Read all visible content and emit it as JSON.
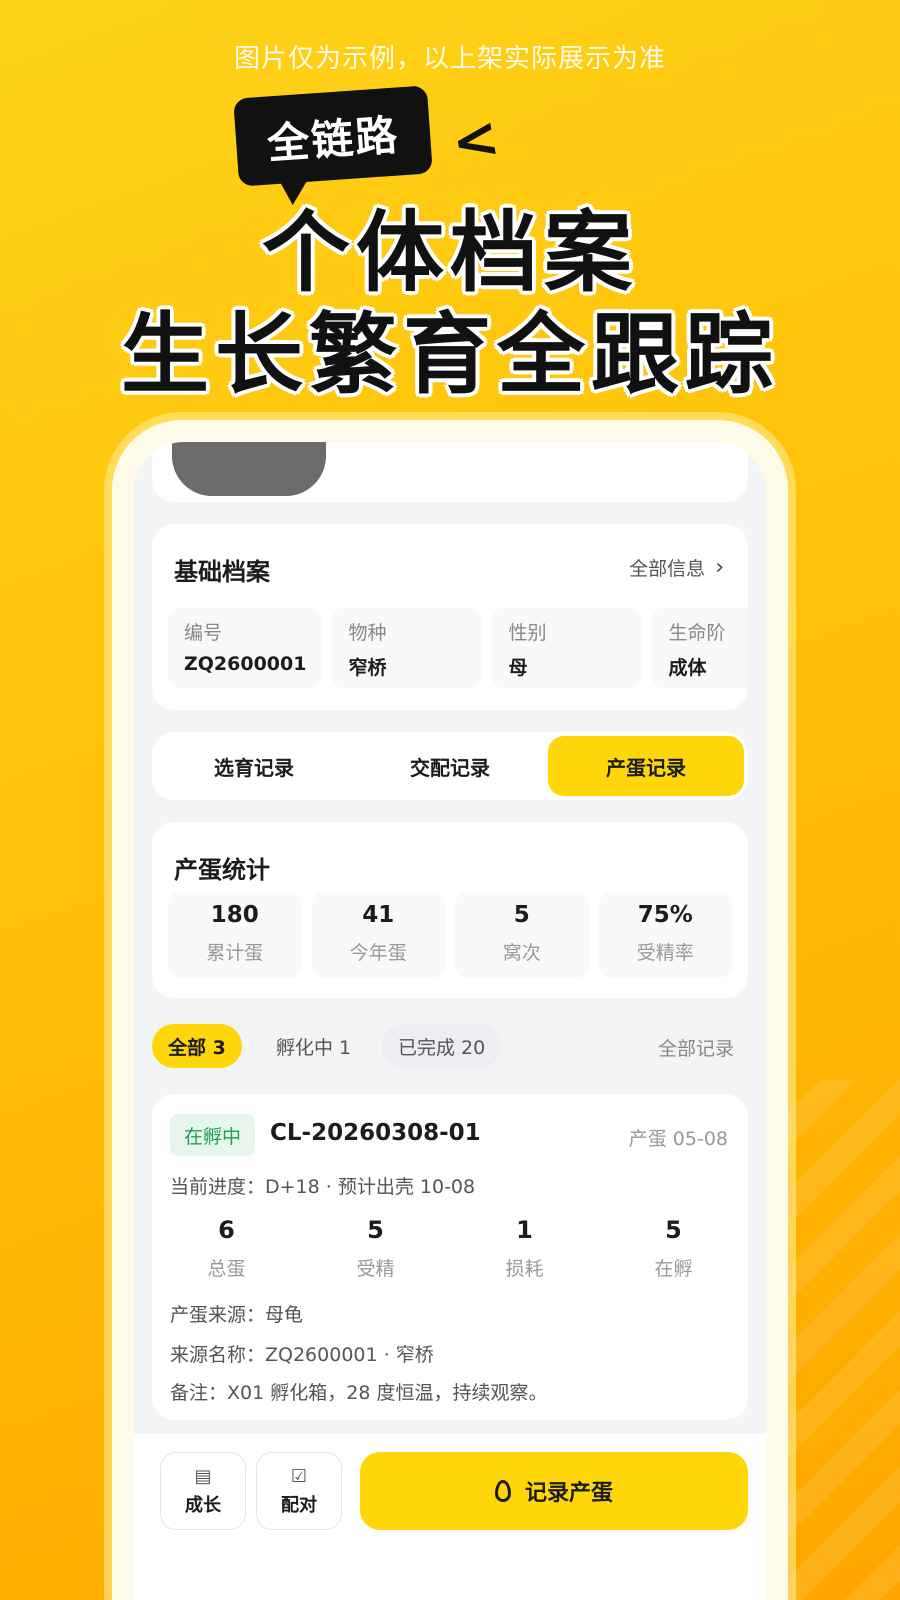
{
  "promo": {
    "disclaimer": "图片仅为示例，以上架实际展示为准",
    "tag": "全链路",
    "headline_1": "个体档案",
    "headline_2": "生长繁育全跟踪"
  },
  "basic_profile": {
    "title": "基础档案",
    "more_label": "全部信息",
    "fields": [
      {
        "label": "编号",
        "value": "ZQ2600001"
      },
      {
        "label": "物种",
        "value": "窄桥"
      },
      {
        "label": "性别",
        "value": "母"
      },
      {
        "label": "生命阶",
        "value": "成体"
      }
    ]
  },
  "tabs": [
    {
      "label": "选育记录",
      "active": false
    },
    {
      "label": "交配记录",
      "active": false
    },
    {
      "label": "产蛋记录",
      "active": true
    }
  ],
  "egg_stats": {
    "title": "产蛋统计",
    "items": [
      {
        "value": "180",
        "label": "累计蛋"
      },
      {
        "value": "41",
        "label": "今年蛋"
      },
      {
        "value": "5",
        "label": "窝次"
      },
      {
        "value": "75%",
        "label": "受精率"
      }
    ]
  },
  "filters": {
    "chips": [
      "全部 3",
      "孵化中 1",
      "已完成 20"
    ],
    "all_records": "全部记录"
  },
  "record": {
    "status": "在孵中",
    "id": "CL-20260308-01",
    "date": "产蛋 05-08",
    "progress": "当前进度：D+18 · 预计出壳 10-08",
    "counts": [
      {
        "value": "6",
        "label": "总蛋"
      },
      {
        "value": "5",
        "label": "受精"
      },
      {
        "value": "1",
        "label": "损耗"
      },
      {
        "value": "5",
        "label": "在孵"
      }
    ],
    "source": "产蛋来源：母龟",
    "source_name": "来源名称：ZQ2600001 · 窄桥",
    "note": "备注：X01 孵化箱，28 度恒温，持续观察。"
  },
  "bottom_bar": {
    "growth_label": "成长",
    "pair_label": "配对",
    "primary_label": "记录产蛋",
    "icons": [
      "clipboard-icon",
      "clipboard-check-icon",
      "egg-icon"
    ]
  },
  "colors": {
    "accent": "#ffd60a",
    "background": "#ffc107",
    "status_green": "#1f9d55"
  }
}
